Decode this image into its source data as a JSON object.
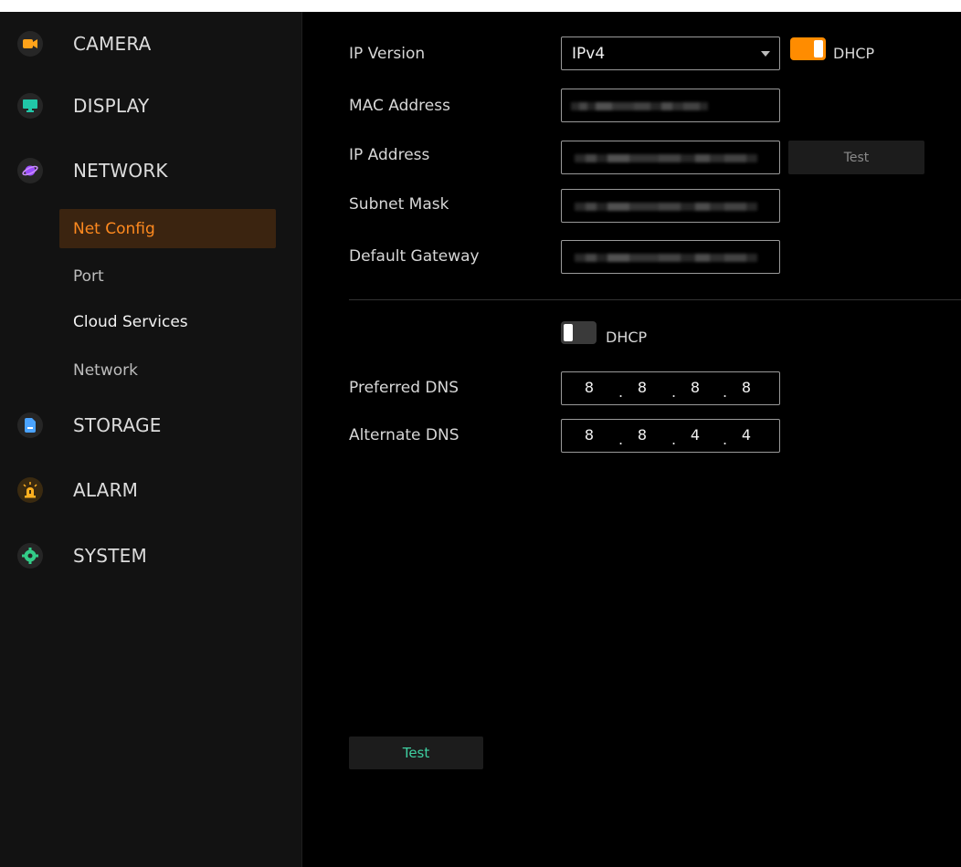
{
  "sidebar": {
    "categories": [
      {
        "label": "CAMERA",
        "icon": "camera-icon",
        "color": "#ff9e1b"
      },
      {
        "label": "DISPLAY",
        "icon": "monitor-icon",
        "color": "#21c7a8"
      },
      {
        "label": "NETWORK",
        "icon": "planet-icon",
        "color": "#a14dff"
      },
      {
        "label": "STORAGE",
        "icon": "storage-icon",
        "color": "#4aa3ff"
      },
      {
        "label": "ALARM",
        "icon": "alarm-light-icon",
        "color": "#ffb020"
      },
      {
        "label": "SYSTEM",
        "icon": "gear-icon",
        "color": "#33cc88"
      }
    ],
    "network_items": [
      {
        "label": "Net Config",
        "active": true
      },
      {
        "label": "Port"
      },
      {
        "label": "Cloud Services"
      },
      {
        "label": "Network"
      }
    ]
  },
  "form": {
    "ip_version": {
      "label": "IP Version",
      "value": "IPv4"
    },
    "dhcp_top": {
      "label": "DHCP",
      "state": "on"
    },
    "mac_address": {
      "label": "MAC Address"
    },
    "ip_address": {
      "label": "IP Address",
      "test_label": "Test"
    },
    "subnet_mask": {
      "label": "Subnet Mask"
    },
    "default_gateway": {
      "label": "Default Gateway"
    },
    "dhcp_dns": {
      "label": "DHCP",
      "state": "off"
    },
    "preferred_dns": {
      "label": "Preferred DNS",
      "octets": [
        "8",
        "8",
        "8",
        "8"
      ]
    },
    "alternate_dns": {
      "label": "Alternate DNS",
      "octets": [
        "8",
        "8",
        "4",
        "4"
      ]
    }
  },
  "footer": {
    "test_label": "Test"
  },
  "colors": {
    "accent": "#ff8c00",
    "active_text": "#ff8a1f",
    "test_text": "#3fd0a2"
  }
}
